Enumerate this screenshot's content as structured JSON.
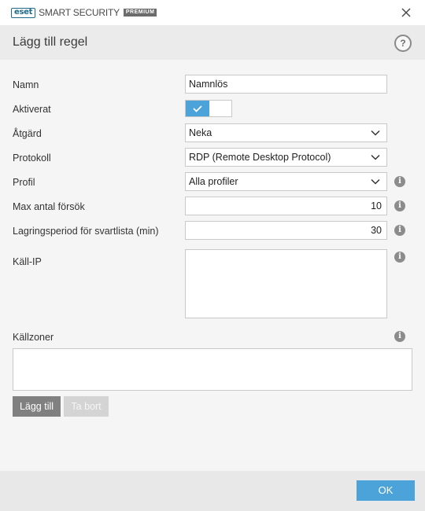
{
  "app": {
    "brand_badge": "eset",
    "brand_name": "SMART SECURITY",
    "brand_tier": "PREMIUM"
  },
  "dialog": {
    "title": "Lägg till regel",
    "help_symbol": "?"
  },
  "form": {
    "name_label": "Namn",
    "name_value": "Namnlös",
    "enabled_label": "Aktiverat",
    "enabled": true,
    "action_label": "Åtgärd",
    "action_value": "Neka",
    "protocol_label": "Protokoll",
    "protocol_value": "RDP (Remote Desktop Protocol)",
    "profile_label": "Profil",
    "profile_value": "Alla profiler",
    "max_attempts_label": "Max antal försök",
    "max_attempts_value": "10",
    "blacklist_period_label": "Lagringsperiod för svartlista (min)",
    "blacklist_period_value": "30",
    "source_ip_label": "Käll-IP",
    "source_ip_value": "",
    "source_zones_label": "Källzoner"
  },
  "buttons": {
    "add": "Lägg till",
    "remove": "Ta bort",
    "ok": "OK"
  },
  "icons": {
    "info": "info-icon",
    "close": "close-icon",
    "check": "check-icon",
    "chevron": "chevron-down-icon"
  },
  "colors": {
    "accent": "#4ba3d9",
    "brand": "#1f6b8a"
  }
}
